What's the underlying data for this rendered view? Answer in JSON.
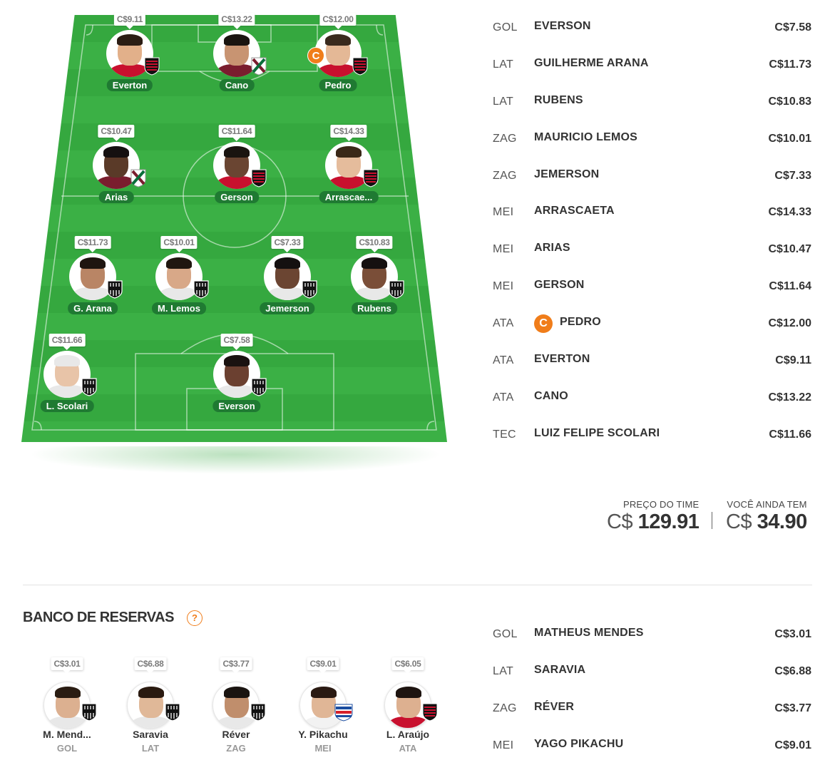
{
  "field": {
    "players": [
      {
        "id": "everton",
        "name": "Everton",
        "price": "C$9.11",
        "club": "flamengo",
        "skin": "#e2b08a",
        "hair": "#2b1d14",
        "captain": false
      },
      {
        "id": "cano",
        "name": "Cano",
        "price": "C$13.22",
        "club": "fluminense",
        "skin": "#c89472",
        "hair": "#1a1410",
        "captain": false
      },
      {
        "id": "pedro",
        "name": "Pedro",
        "price": "C$12.00",
        "club": "flamengo",
        "skin": "#e4b896",
        "hair": "#3a2a1e",
        "captain": true,
        "captain_label": "C"
      },
      {
        "id": "arias",
        "name": "Arias",
        "price": "C$10.47",
        "club": "fluminense",
        "skin": "#5a3a28",
        "hair": "#151010",
        "captain": false
      },
      {
        "id": "gerson",
        "name": "Gerson",
        "price": "C$11.64",
        "club": "flamengo",
        "skin": "#6a4532",
        "hair": "#1a1410",
        "captain": false
      },
      {
        "id": "arrascaeta",
        "name": "Arrascae...",
        "price": "C$14.33",
        "club": "flamengo",
        "skin": "#e5bc9c",
        "hair": "#3a2818",
        "captain": false
      },
      {
        "id": "garana",
        "name": "G. Arana",
        "price": "C$11.73",
        "club": "atletico",
        "skin": "#b98565",
        "hair": "#1e1510",
        "captain": false
      },
      {
        "id": "mlemos",
        "name": "M. Lemos",
        "price": "C$10.01",
        "club": "atletico",
        "skin": "#d8a888",
        "hair": "#201610",
        "captain": false
      },
      {
        "id": "jemerson",
        "name": "Jemerson",
        "price": "C$7.33",
        "club": "atletico",
        "skin": "#6b4532",
        "hair": "#141010",
        "captain": false
      },
      {
        "id": "rubens",
        "name": "Rubens",
        "price": "C$10.83",
        "club": "atletico",
        "skin": "#7a4e38",
        "hair": "#151010",
        "captain": false
      },
      {
        "id": "scolari",
        "name": "L. Scolari",
        "price": "C$11.66",
        "club": "atletico",
        "skin": "#e8c4a8",
        "hair": "#e8e8e8",
        "captain": false
      },
      {
        "id": "everson",
        "name": "Everson",
        "price": "C$7.58",
        "club": "atletico",
        "skin": "#6b4030",
        "hair": "#1a1210",
        "captain": false
      }
    ]
  },
  "lineup": [
    {
      "pos": "GOL",
      "name": "EVERSON",
      "price": "C$7.58",
      "captain": false
    },
    {
      "pos": "LAT",
      "name": "GUILHERME ARANA",
      "price": "C$11.73",
      "captain": false
    },
    {
      "pos": "LAT",
      "name": "RUBENS",
      "price": "C$10.83",
      "captain": false
    },
    {
      "pos": "ZAG",
      "name": "MAURICIO LEMOS",
      "price": "C$10.01",
      "captain": false
    },
    {
      "pos": "ZAG",
      "name": "JEMERSON",
      "price": "C$7.33",
      "captain": false
    },
    {
      "pos": "MEI",
      "name": "ARRASCAETA",
      "price": "C$14.33",
      "captain": false
    },
    {
      "pos": "MEI",
      "name": "ARIAS",
      "price": "C$10.47",
      "captain": false
    },
    {
      "pos": "MEI",
      "name": "GERSON",
      "price": "C$11.64",
      "captain": false
    },
    {
      "pos": "ATA",
      "name": "PEDRO",
      "price": "C$12.00",
      "captain": true,
      "captain_label": "C"
    },
    {
      "pos": "ATA",
      "name": "EVERTON",
      "price": "C$9.11",
      "captain": false
    },
    {
      "pos": "ATA",
      "name": "CANO",
      "price": "C$13.22",
      "captain": false
    },
    {
      "pos": "TEC",
      "name": "LUIZ FELIPE SCOLARI",
      "price": "C$11.66",
      "captain": false
    }
  ],
  "totals": {
    "team_price_label": "PREÇO DO TIME",
    "team_price_currency": "C$",
    "team_price_value": "129.91",
    "remaining_label": "VOCÊ AINDA TEM",
    "remaining_currency": "C$",
    "remaining_value": "34.90"
  },
  "bench": {
    "title": "BANCO DE RESERVAS",
    "help_label": "?",
    "players": [
      {
        "name": "M. Mend...",
        "pos": "GOL",
        "price": "C$3.01",
        "club": "atletico",
        "skin": "#dcb090",
        "hair": "#2a1c12"
      },
      {
        "name": "Saravia",
        "pos": "LAT",
        "price": "C$6.88",
        "club": "atletico",
        "skin": "#e0b898",
        "hair": "#2a1a10"
      },
      {
        "name": "Réver",
        "pos": "ZAG",
        "price": "C$3.77",
        "club": "atletico",
        "skin": "#c08e6c",
        "hair": "#1a1410"
      },
      {
        "name": "Y. Pikachu",
        "pos": "MEI",
        "price": "C$9.01",
        "club": "fortaleza",
        "skin": "#e0b696",
        "hair": "#2a1a12"
      },
      {
        "name": "L. Araújo",
        "pos": "ATA",
        "price": "C$6.05",
        "club": "flamengo",
        "skin": "#ddb090",
        "hair": "#1e1410"
      }
    ],
    "list": [
      {
        "pos": "GOL",
        "name": "MATHEUS MENDES",
        "price": "C$3.01"
      },
      {
        "pos": "LAT",
        "name": "SARAVIA",
        "price": "C$6.88"
      },
      {
        "pos": "ZAG",
        "name": "RÉVER",
        "price": "C$3.77"
      },
      {
        "pos": "MEI",
        "name": "YAGO PIKACHU",
        "price": "C$9.01"
      }
    ]
  },
  "colors": {
    "accent_orange": "#f07d1a",
    "pill_green": "#1f7a32",
    "flamengo_red": "#c8102e",
    "fluminense_maroon": "#7a1d2e",
    "fluminense_green": "#0a6e3a",
    "atletico_black": "#111111"
  }
}
